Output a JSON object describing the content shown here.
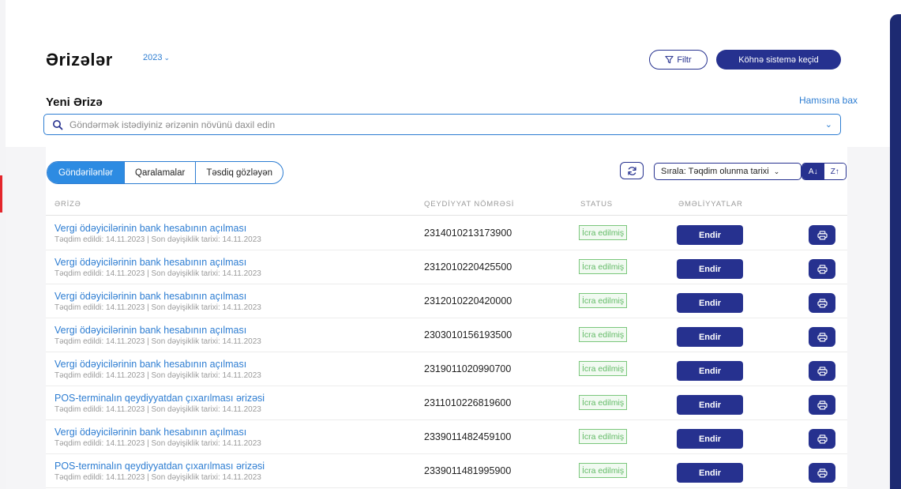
{
  "header": {
    "title": "Ərizələr",
    "year": "2023",
    "filter_label": "Filtr",
    "old_system_label": "Köhnə sistemə keçid"
  },
  "new_application": {
    "title": "Yeni Ərizə",
    "see_all_label": "Hamısına bax",
    "search_placeholder": "Göndərmək istədiyiniz ərizənin növünü daxil edin"
  },
  "tabs": [
    {
      "label": "Göndərilənlər",
      "active": true
    },
    {
      "label": "Qaralamalar",
      "active": false
    },
    {
      "label": "Təsdiq gözləyən",
      "active": false
    }
  ],
  "sort": {
    "label": "Sırala: Təqdim olunma tarixi",
    "asc_label": "A↓",
    "desc_label": "Z↑"
  },
  "table": {
    "columns": [
      "ƏRİZƏ",
      "QEYDİYYAT NÖMRƏSİ",
      "STATUS",
      "ƏMƏLİYYATLAR"
    ],
    "rows": [
      {
        "title": "Vergi ödəyicilərinin bank hesabının açılması",
        "meta": "Təqdim edildi: 14.11.2023 | Son dəyişiklik tarixi: 14.11.2023",
        "reg_no": "2314010213173900",
        "status": "İcra edilmiş",
        "action": "Endir"
      },
      {
        "title": "Vergi ödəyicilərinin bank hesabının açılması",
        "meta": "Təqdim edildi: 14.11.2023 | Son dəyişiklik tarixi: 14.11.2023",
        "reg_no": "2312010220425500",
        "status": "İcra edilmiş",
        "action": "Endir"
      },
      {
        "title": "Vergi ödəyicilərinin bank hesabının açılması",
        "meta": "Təqdim edildi: 14.11.2023 | Son dəyişiklik tarixi: 14.11.2023",
        "reg_no": "2312010220420000",
        "status": "İcra edilmiş",
        "action": "Endir"
      },
      {
        "title": "Vergi ödəyicilərinin bank hesabının açılması",
        "meta": "Təqdim edildi: 14.11.2023 | Son dəyişiklik tarixi: 14.11.2023",
        "reg_no": "2303010156193500",
        "status": "İcra edilmiş",
        "action": "Endir"
      },
      {
        "title": "Vergi ödəyicilərinin bank hesabının açılması",
        "meta": "Təqdim edildi: 14.11.2023 | Son dəyişiklik tarixi: 14.11.2023",
        "reg_no": "2319011020990700",
        "status": "İcra edilmiş",
        "action": "Endir"
      },
      {
        "title": "POS-terminalın qeydiyyatdan çıxarılması ərizəsi",
        "meta": "Təqdim edildi: 14.11.2023 | Son dəyişiklik tarixi: 14.11.2023",
        "reg_no": "2311010226819600",
        "status": "İcra edilmiş",
        "action": "Endir"
      },
      {
        "title": "Vergi ödəyicilərinin bank hesabının açılması",
        "meta": "Təqdim edildi: 14.11.2023 | Son dəyişiklik tarixi: 14.11.2023",
        "reg_no": "2339011482459100",
        "status": "İcra edilmiş",
        "action": "Endir"
      },
      {
        "title": "POS-terminalın qeydiyyatdan çıxarılması ərizəsi",
        "meta": "Təqdim edildi: 14.11.2023 | Son dəyişiklik tarixi: 14.11.2023",
        "reg_no": "2339011481995900",
        "status": "İcra edilmiş",
        "action": "Endir"
      }
    ]
  },
  "colors": {
    "primary": "#26318f",
    "link": "#2d7dd2",
    "tab_active": "#2d8be2",
    "status_green": "#64bb68"
  }
}
